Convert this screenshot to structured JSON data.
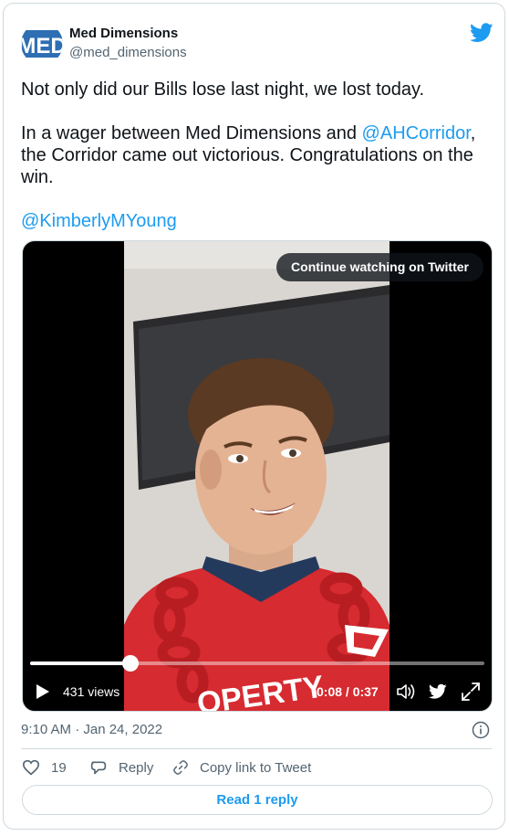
{
  "author": {
    "name": "Med Dimensions",
    "handle": "@med_dimensions",
    "avatar_text": "MED"
  },
  "tweet": {
    "line1": "Not only did our Bills lose last night, we lost today.",
    "para2_before": "In a wager between Med Dimensions and ",
    "para2_mention": "@AHCorridor",
    "para2_after": ", the Corridor came out victorious. Congratulations on the win.",
    "mention_line": "@KimberlyMYoung"
  },
  "video": {
    "continue_label": "Continue watching on Twitter",
    "views": "431 views",
    "time": "0:08 / 0:37",
    "progress": 0.22,
    "shirt_text": "OPERTY"
  },
  "footer": {
    "timestamp": "9:10 AM · Jan 24, 2022",
    "like_count": "19",
    "reply_label": "Reply",
    "copy_label": "Copy link to Tweet",
    "read_reply_label": "Read 1 reply"
  },
  "colors": {
    "accent": "#1d9bf0",
    "text": "#0f1419",
    "muted": "#536471",
    "border": "#cfd9de"
  },
  "icons": [
    "twitter-bird-icon",
    "play-icon",
    "volume-icon",
    "expand-icon",
    "info-icon",
    "heart-icon",
    "reply-bubble-icon",
    "link-icon"
  ]
}
